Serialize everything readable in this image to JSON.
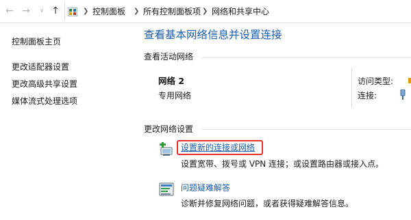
{
  "address_bar": {
    "breadcrumbs": [
      "控制面板",
      "所有控制面板项",
      "网络和共享中心"
    ]
  },
  "sidebar": {
    "items": [
      {
        "label": "控制面板主页"
      },
      {
        "label": "更改适配器设置"
      },
      {
        "label": "更改高级共享设置"
      },
      {
        "label": "媒体流式处理选项"
      }
    ]
  },
  "main": {
    "title": "查看基本网络信息并设置连接",
    "active_networks": {
      "heading": "查看活动网络",
      "network_name": "网络 2",
      "network_type": "专用网络",
      "access_type_label": "访问类型:",
      "connections_label": "连接:"
    },
    "change_settings": {
      "heading": "更改网络设置",
      "tasks": [
        {
          "icon": "new-connection-icon",
          "link": "设置新的连接或网络",
          "description": "设置宽带、拨号或 VPN 连接；或设置路由器或接入点。",
          "highlighted": true
        },
        {
          "icon": "troubleshoot-icon",
          "link": "问题疑难解答",
          "description": "诊断并修复网络问题，或者获得疑难解答信息。",
          "highlighted": false
        }
      ]
    }
  },
  "colors": {
    "link_blue": "#1d5cad",
    "highlight_red": "#e5302a"
  }
}
